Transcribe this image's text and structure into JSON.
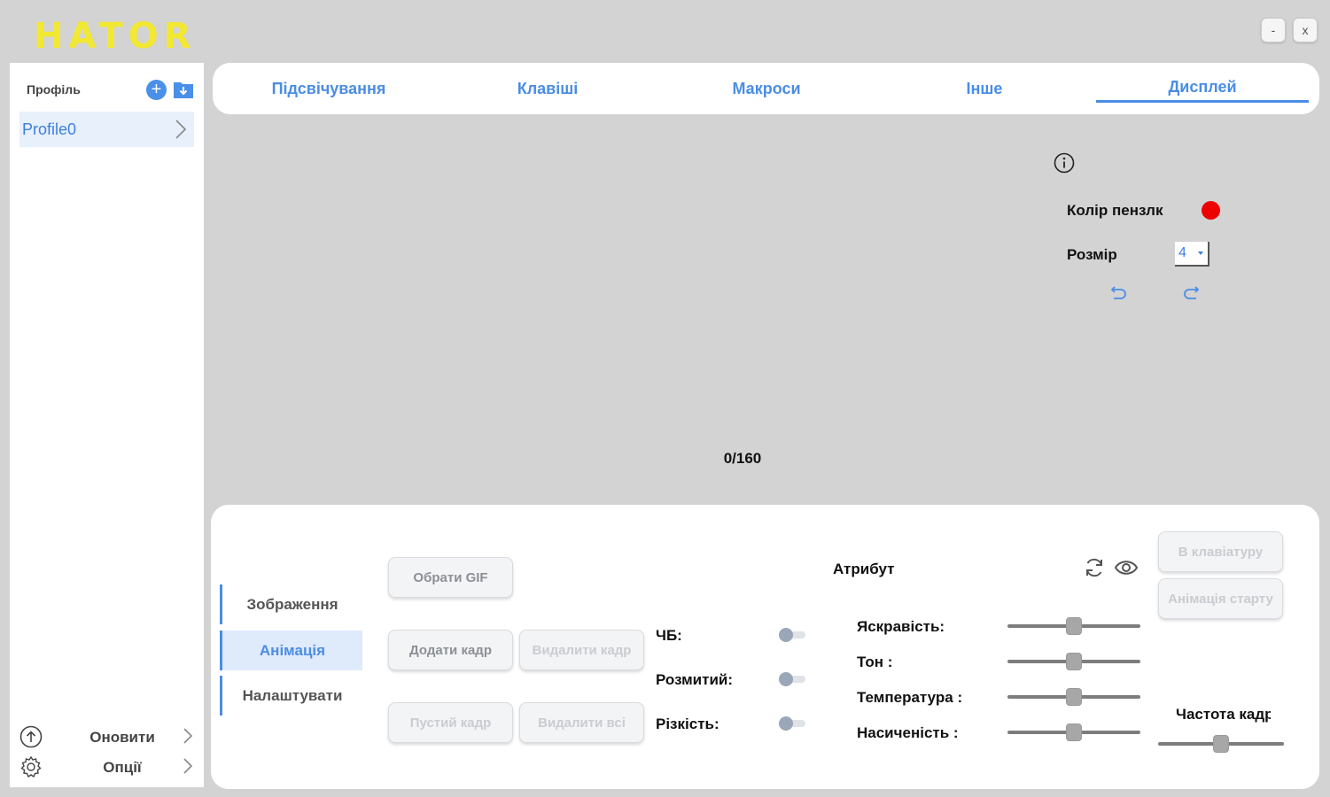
{
  "app": {
    "logo": "HATOR",
    "minimize": "-",
    "close": "x"
  },
  "sidebar": {
    "title": "Профіль",
    "profiles": [
      {
        "label": "Profile0"
      }
    ],
    "update_label": "Оновити",
    "options_label": "Опції"
  },
  "tabs": [
    {
      "label": "Підсвічування"
    },
    {
      "label": "Клавіші"
    },
    {
      "label": "Макроси"
    },
    {
      "label": "Інше"
    },
    {
      "label": "Дисплей",
      "active": true
    }
  ],
  "display": {
    "brush_color_label": "Колір пензлк",
    "brush_color": "#ee0000",
    "size_label": "Розмір",
    "size_value": "4",
    "counter": "0/160"
  },
  "bottom": {
    "subtabs": [
      {
        "label": "Зображення"
      },
      {
        "label": "Анімація",
        "active": true
      },
      {
        "label": "Налаштувати"
      }
    ],
    "buttons": {
      "choose_gif": "Обрати GIF",
      "add_frame": "Додати кадр",
      "delete_frame": "Видалити кадр",
      "empty_frame": "Пустий кадр",
      "delete_all": "Видалити всі",
      "to_keyboard": "В клавіатуру",
      "start_animation": "Анімація старту"
    },
    "toggles": [
      {
        "label": "ЧБ:",
        "on": false
      },
      {
        "label": "Розмитий:",
        "on": false
      },
      {
        "label": "Різкість:",
        "on": false
      }
    ],
    "attribute_label": "Атрибут",
    "sliders": [
      {
        "label": "Яскравість:",
        "value": 0.5
      },
      {
        "label": "Тон :",
        "value": 0.5
      },
      {
        "label": "Температура :",
        "value": 0.5
      },
      {
        "label": "Насиченість :",
        "value": 0.5
      }
    ],
    "frame_rate_label": "Частота кадр",
    "frame_rate_value": 0.5
  },
  "colors": {
    "accent": "#4a8de6",
    "logo": "#f2e832",
    "background": "#d3d3d3"
  }
}
